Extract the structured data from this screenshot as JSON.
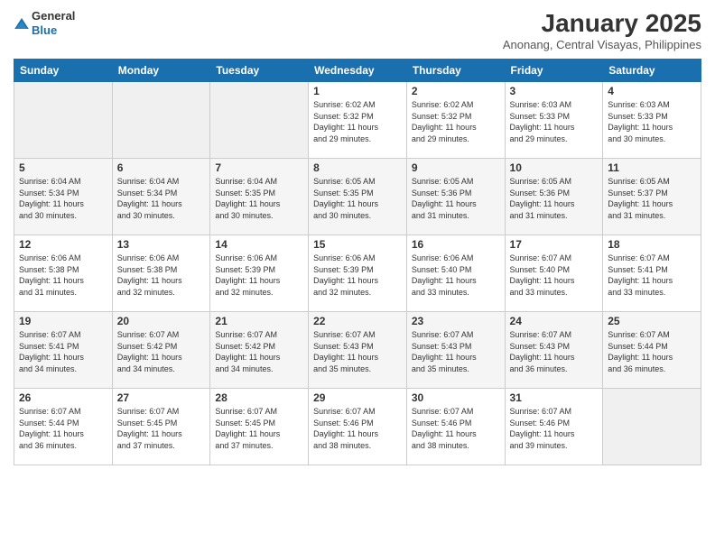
{
  "header": {
    "logo_general": "General",
    "logo_blue": "Blue",
    "month_title": "January 2025",
    "location": "Anonang, Central Visayas, Philippines"
  },
  "weekdays": [
    "Sunday",
    "Monday",
    "Tuesday",
    "Wednesday",
    "Thursday",
    "Friday",
    "Saturday"
  ],
  "weeks": [
    [
      {
        "day": "",
        "info": ""
      },
      {
        "day": "",
        "info": ""
      },
      {
        "day": "",
        "info": ""
      },
      {
        "day": "1",
        "info": "Sunrise: 6:02 AM\nSunset: 5:32 PM\nDaylight: 11 hours\nand 29 minutes."
      },
      {
        "day": "2",
        "info": "Sunrise: 6:02 AM\nSunset: 5:32 PM\nDaylight: 11 hours\nand 29 minutes."
      },
      {
        "day": "3",
        "info": "Sunrise: 6:03 AM\nSunset: 5:33 PM\nDaylight: 11 hours\nand 29 minutes."
      },
      {
        "day": "4",
        "info": "Sunrise: 6:03 AM\nSunset: 5:33 PM\nDaylight: 11 hours\nand 30 minutes."
      }
    ],
    [
      {
        "day": "5",
        "info": "Sunrise: 6:04 AM\nSunset: 5:34 PM\nDaylight: 11 hours\nand 30 minutes."
      },
      {
        "day": "6",
        "info": "Sunrise: 6:04 AM\nSunset: 5:34 PM\nDaylight: 11 hours\nand 30 minutes."
      },
      {
        "day": "7",
        "info": "Sunrise: 6:04 AM\nSunset: 5:35 PM\nDaylight: 11 hours\nand 30 minutes."
      },
      {
        "day": "8",
        "info": "Sunrise: 6:05 AM\nSunset: 5:35 PM\nDaylight: 11 hours\nand 30 minutes."
      },
      {
        "day": "9",
        "info": "Sunrise: 6:05 AM\nSunset: 5:36 PM\nDaylight: 11 hours\nand 31 minutes."
      },
      {
        "day": "10",
        "info": "Sunrise: 6:05 AM\nSunset: 5:36 PM\nDaylight: 11 hours\nand 31 minutes."
      },
      {
        "day": "11",
        "info": "Sunrise: 6:05 AM\nSunset: 5:37 PM\nDaylight: 11 hours\nand 31 minutes."
      }
    ],
    [
      {
        "day": "12",
        "info": "Sunrise: 6:06 AM\nSunset: 5:38 PM\nDaylight: 11 hours\nand 31 minutes."
      },
      {
        "day": "13",
        "info": "Sunrise: 6:06 AM\nSunset: 5:38 PM\nDaylight: 11 hours\nand 32 minutes."
      },
      {
        "day": "14",
        "info": "Sunrise: 6:06 AM\nSunset: 5:39 PM\nDaylight: 11 hours\nand 32 minutes."
      },
      {
        "day": "15",
        "info": "Sunrise: 6:06 AM\nSunset: 5:39 PM\nDaylight: 11 hours\nand 32 minutes."
      },
      {
        "day": "16",
        "info": "Sunrise: 6:06 AM\nSunset: 5:40 PM\nDaylight: 11 hours\nand 33 minutes."
      },
      {
        "day": "17",
        "info": "Sunrise: 6:07 AM\nSunset: 5:40 PM\nDaylight: 11 hours\nand 33 minutes."
      },
      {
        "day": "18",
        "info": "Sunrise: 6:07 AM\nSunset: 5:41 PM\nDaylight: 11 hours\nand 33 minutes."
      }
    ],
    [
      {
        "day": "19",
        "info": "Sunrise: 6:07 AM\nSunset: 5:41 PM\nDaylight: 11 hours\nand 34 minutes."
      },
      {
        "day": "20",
        "info": "Sunrise: 6:07 AM\nSunset: 5:42 PM\nDaylight: 11 hours\nand 34 minutes."
      },
      {
        "day": "21",
        "info": "Sunrise: 6:07 AM\nSunset: 5:42 PM\nDaylight: 11 hours\nand 34 minutes."
      },
      {
        "day": "22",
        "info": "Sunrise: 6:07 AM\nSunset: 5:43 PM\nDaylight: 11 hours\nand 35 minutes."
      },
      {
        "day": "23",
        "info": "Sunrise: 6:07 AM\nSunset: 5:43 PM\nDaylight: 11 hours\nand 35 minutes."
      },
      {
        "day": "24",
        "info": "Sunrise: 6:07 AM\nSunset: 5:43 PM\nDaylight: 11 hours\nand 36 minutes."
      },
      {
        "day": "25",
        "info": "Sunrise: 6:07 AM\nSunset: 5:44 PM\nDaylight: 11 hours\nand 36 minutes."
      }
    ],
    [
      {
        "day": "26",
        "info": "Sunrise: 6:07 AM\nSunset: 5:44 PM\nDaylight: 11 hours\nand 36 minutes."
      },
      {
        "day": "27",
        "info": "Sunrise: 6:07 AM\nSunset: 5:45 PM\nDaylight: 11 hours\nand 37 minutes."
      },
      {
        "day": "28",
        "info": "Sunrise: 6:07 AM\nSunset: 5:45 PM\nDaylight: 11 hours\nand 37 minutes."
      },
      {
        "day": "29",
        "info": "Sunrise: 6:07 AM\nSunset: 5:46 PM\nDaylight: 11 hours\nand 38 minutes."
      },
      {
        "day": "30",
        "info": "Sunrise: 6:07 AM\nSunset: 5:46 PM\nDaylight: 11 hours\nand 38 minutes."
      },
      {
        "day": "31",
        "info": "Sunrise: 6:07 AM\nSunset: 5:46 PM\nDaylight: 11 hours\nand 39 minutes."
      },
      {
        "day": "",
        "info": ""
      }
    ]
  ]
}
